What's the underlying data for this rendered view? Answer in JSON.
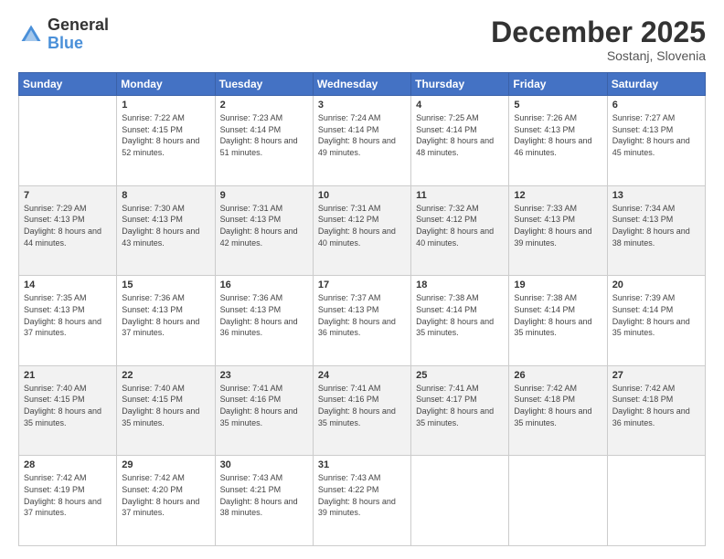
{
  "header": {
    "logo_general": "General",
    "logo_blue": "Blue",
    "month_title": "December 2025",
    "location": "Sostanj, Slovenia"
  },
  "weekdays": [
    "Sunday",
    "Monday",
    "Tuesday",
    "Wednesday",
    "Thursday",
    "Friday",
    "Saturday"
  ],
  "weeks": [
    [
      {
        "day": "",
        "sunrise": "",
        "sunset": "",
        "daylight": ""
      },
      {
        "day": "1",
        "sunrise": "Sunrise: 7:22 AM",
        "sunset": "Sunset: 4:15 PM",
        "daylight": "Daylight: 8 hours and 52 minutes."
      },
      {
        "day": "2",
        "sunrise": "Sunrise: 7:23 AM",
        "sunset": "Sunset: 4:14 PM",
        "daylight": "Daylight: 8 hours and 51 minutes."
      },
      {
        "day": "3",
        "sunrise": "Sunrise: 7:24 AM",
        "sunset": "Sunset: 4:14 PM",
        "daylight": "Daylight: 8 hours and 49 minutes."
      },
      {
        "day": "4",
        "sunrise": "Sunrise: 7:25 AM",
        "sunset": "Sunset: 4:14 PM",
        "daylight": "Daylight: 8 hours and 48 minutes."
      },
      {
        "day": "5",
        "sunrise": "Sunrise: 7:26 AM",
        "sunset": "Sunset: 4:13 PM",
        "daylight": "Daylight: 8 hours and 46 minutes."
      },
      {
        "day": "6",
        "sunrise": "Sunrise: 7:27 AM",
        "sunset": "Sunset: 4:13 PM",
        "daylight": "Daylight: 8 hours and 45 minutes."
      }
    ],
    [
      {
        "day": "7",
        "sunrise": "Sunrise: 7:29 AM",
        "sunset": "Sunset: 4:13 PM",
        "daylight": "Daylight: 8 hours and 44 minutes."
      },
      {
        "day": "8",
        "sunrise": "Sunrise: 7:30 AM",
        "sunset": "Sunset: 4:13 PM",
        "daylight": "Daylight: 8 hours and 43 minutes."
      },
      {
        "day": "9",
        "sunrise": "Sunrise: 7:31 AM",
        "sunset": "Sunset: 4:13 PM",
        "daylight": "Daylight: 8 hours and 42 minutes."
      },
      {
        "day": "10",
        "sunrise": "Sunrise: 7:31 AM",
        "sunset": "Sunset: 4:12 PM",
        "daylight": "Daylight: 8 hours and 40 minutes."
      },
      {
        "day": "11",
        "sunrise": "Sunrise: 7:32 AM",
        "sunset": "Sunset: 4:12 PM",
        "daylight": "Daylight: 8 hours and 40 minutes."
      },
      {
        "day": "12",
        "sunrise": "Sunrise: 7:33 AM",
        "sunset": "Sunset: 4:13 PM",
        "daylight": "Daylight: 8 hours and 39 minutes."
      },
      {
        "day": "13",
        "sunrise": "Sunrise: 7:34 AM",
        "sunset": "Sunset: 4:13 PM",
        "daylight": "Daylight: 8 hours and 38 minutes."
      }
    ],
    [
      {
        "day": "14",
        "sunrise": "Sunrise: 7:35 AM",
        "sunset": "Sunset: 4:13 PM",
        "daylight": "Daylight: 8 hours and 37 minutes."
      },
      {
        "day": "15",
        "sunrise": "Sunrise: 7:36 AM",
        "sunset": "Sunset: 4:13 PM",
        "daylight": "Daylight: 8 hours and 37 minutes."
      },
      {
        "day": "16",
        "sunrise": "Sunrise: 7:36 AM",
        "sunset": "Sunset: 4:13 PM",
        "daylight": "Daylight: 8 hours and 36 minutes."
      },
      {
        "day": "17",
        "sunrise": "Sunrise: 7:37 AM",
        "sunset": "Sunset: 4:13 PM",
        "daylight": "Daylight: 8 hours and 36 minutes."
      },
      {
        "day": "18",
        "sunrise": "Sunrise: 7:38 AM",
        "sunset": "Sunset: 4:14 PM",
        "daylight": "Daylight: 8 hours and 35 minutes."
      },
      {
        "day": "19",
        "sunrise": "Sunrise: 7:38 AM",
        "sunset": "Sunset: 4:14 PM",
        "daylight": "Daylight: 8 hours and 35 minutes."
      },
      {
        "day": "20",
        "sunrise": "Sunrise: 7:39 AM",
        "sunset": "Sunset: 4:14 PM",
        "daylight": "Daylight: 8 hours and 35 minutes."
      }
    ],
    [
      {
        "day": "21",
        "sunrise": "Sunrise: 7:40 AM",
        "sunset": "Sunset: 4:15 PM",
        "daylight": "Daylight: 8 hours and 35 minutes."
      },
      {
        "day": "22",
        "sunrise": "Sunrise: 7:40 AM",
        "sunset": "Sunset: 4:15 PM",
        "daylight": "Daylight: 8 hours and 35 minutes."
      },
      {
        "day": "23",
        "sunrise": "Sunrise: 7:41 AM",
        "sunset": "Sunset: 4:16 PM",
        "daylight": "Daylight: 8 hours and 35 minutes."
      },
      {
        "day": "24",
        "sunrise": "Sunrise: 7:41 AM",
        "sunset": "Sunset: 4:16 PM",
        "daylight": "Daylight: 8 hours and 35 minutes."
      },
      {
        "day": "25",
        "sunrise": "Sunrise: 7:41 AM",
        "sunset": "Sunset: 4:17 PM",
        "daylight": "Daylight: 8 hours and 35 minutes."
      },
      {
        "day": "26",
        "sunrise": "Sunrise: 7:42 AM",
        "sunset": "Sunset: 4:18 PM",
        "daylight": "Daylight: 8 hours and 35 minutes."
      },
      {
        "day": "27",
        "sunrise": "Sunrise: 7:42 AM",
        "sunset": "Sunset: 4:18 PM",
        "daylight": "Daylight: 8 hours and 36 minutes."
      }
    ],
    [
      {
        "day": "28",
        "sunrise": "Sunrise: 7:42 AM",
        "sunset": "Sunset: 4:19 PM",
        "daylight": "Daylight: 8 hours and 37 minutes."
      },
      {
        "day": "29",
        "sunrise": "Sunrise: 7:42 AM",
        "sunset": "Sunset: 4:20 PM",
        "daylight": "Daylight: 8 hours and 37 minutes."
      },
      {
        "day": "30",
        "sunrise": "Sunrise: 7:43 AM",
        "sunset": "Sunset: 4:21 PM",
        "daylight": "Daylight: 8 hours and 38 minutes."
      },
      {
        "day": "31",
        "sunrise": "Sunrise: 7:43 AM",
        "sunset": "Sunset: 4:22 PM",
        "daylight": "Daylight: 8 hours and 39 minutes."
      },
      {
        "day": "",
        "sunrise": "",
        "sunset": "",
        "daylight": ""
      },
      {
        "day": "",
        "sunrise": "",
        "sunset": "",
        "daylight": ""
      },
      {
        "day": "",
        "sunrise": "",
        "sunset": "",
        "daylight": ""
      }
    ]
  ]
}
